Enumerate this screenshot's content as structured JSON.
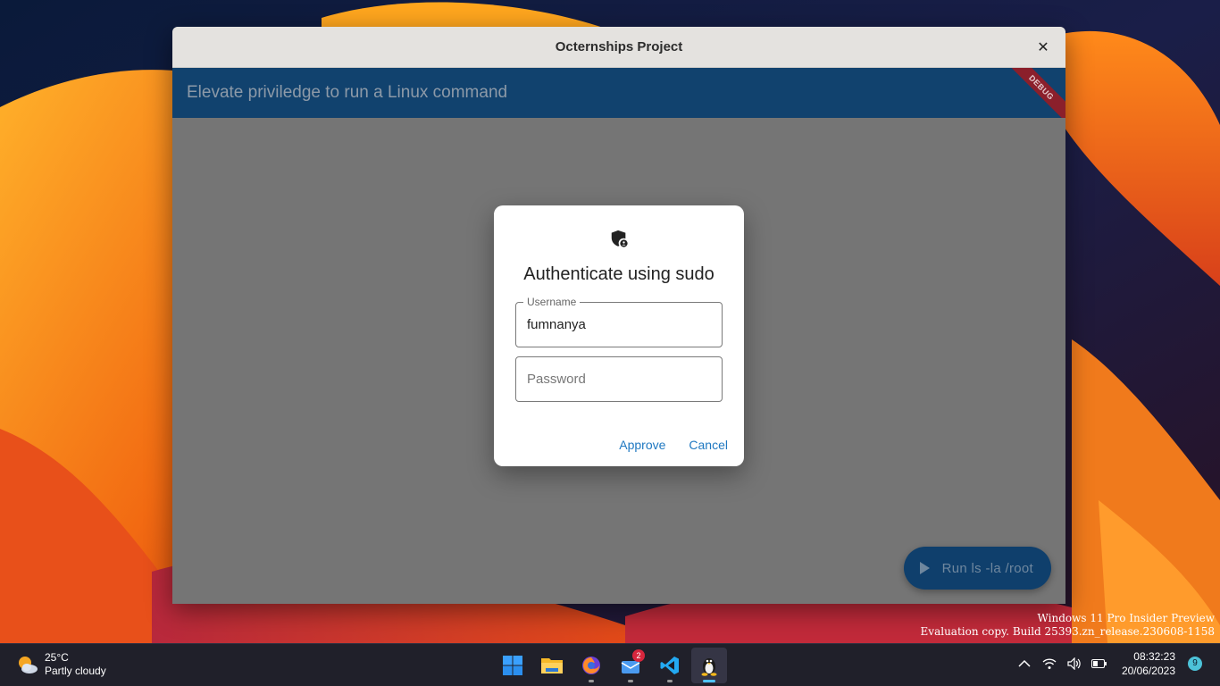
{
  "window": {
    "title": "Octernships Project",
    "close_glyph": "✕",
    "appbar_title": "Elevate priviledge to run a Linux command",
    "debug_banner": "DEBUG",
    "fab_label": "Run ls -la /root"
  },
  "dialog": {
    "icon": "shield-lock-icon",
    "title": "Authenticate using sudo",
    "username_label": "Username",
    "username_value": "fumnanya",
    "password_placeholder": "Password",
    "approve_label": "Approve",
    "cancel_label": "Cancel"
  },
  "watermark": {
    "line1": "Windows 11 Pro Insider Preview",
    "line2": "Evaluation copy. Build 25393.zn_release.230608-1158"
  },
  "taskbar": {
    "weather": {
      "temperature": "25°C",
      "condition": "Partly cloudy"
    },
    "apps": [
      {
        "name": "windows-start-icon"
      },
      {
        "name": "file-explorer-icon"
      },
      {
        "name": "firefox-icon"
      },
      {
        "name": "mail-icon",
        "badge": "2"
      },
      {
        "name": "vscode-icon"
      },
      {
        "name": "linux-tux-icon",
        "active": true
      }
    ],
    "clock": {
      "time": "08:32:23",
      "date": "20/06/2023"
    },
    "notification_count": "9"
  },
  "colors": {
    "appbar": "#11426e",
    "dialog_accent": "#1f78c1",
    "debug_banner": "#8b1f2b"
  }
}
